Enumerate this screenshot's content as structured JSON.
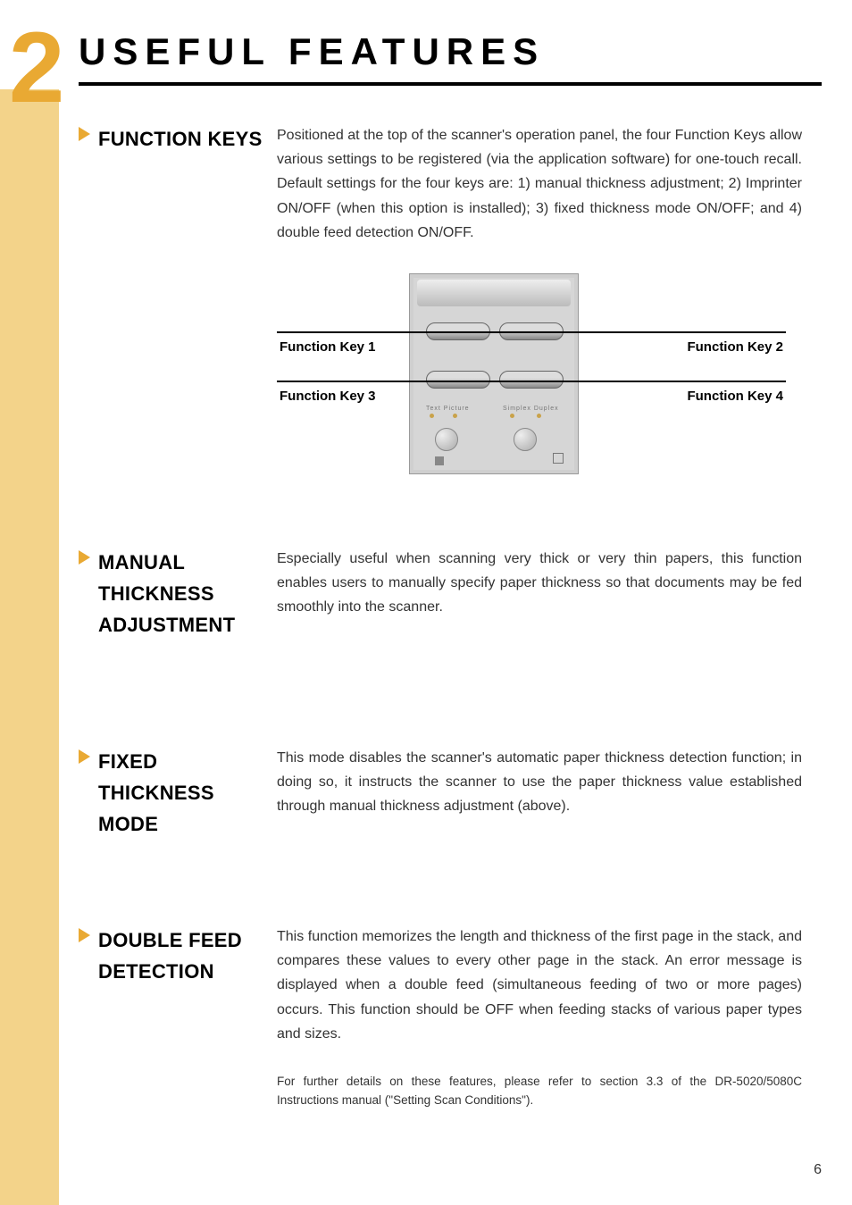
{
  "chapter": {
    "number": "2",
    "title": "USEFUL FEATURES"
  },
  "sections": {
    "function_keys": {
      "heading": "FUNCTION KEYS",
      "body": "Positioned at the top of the scanner's operation panel, the four Function Keys allow various settings to be registered (via the application software) for one-touch recall. Default settings for the four keys are: 1) manual thickness adjustment; 2) Imprinter ON/OFF (when this option is installed); 3) fixed thickness mode ON/OFF; and 4) double feed detection ON/OFF.",
      "fk1": "Function Key 1",
      "fk2": "Function Key 2",
      "fk3": "Function Key 3",
      "fk4": "Function Key 4",
      "panel_labels": {
        "row1": "Text   Picture",
        "row2": "Simplex  Duplex"
      }
    },
    "manual_thickness": {
      "heading": "MANUAL THICKNESS ADJUSTMENT",
      "body": "Especially useful when scanning very thick or very thin papers, this function enables users to manually specify paper thickness so that documents may be fed smoothly into the scanner."
    },
    "fixed_thickness": {
      "heading": "FIXED THICKNESS MODE",
      "body": "This mode disables the scanner's automatic paper thickness detection function; in doing so, it instructs the scanner to use the paper thickness value established through manual thickness adjustment (above)."
    },
    "double_feed": {
      "heading": "DOUBLE FEED DETECTION",
      "body": "This function memorizes the length and thickness of the first page in the stack, and compares these values to every other page in the stack. An error message is displayed when a double feed (simultaneous feeding of two or more pages) occurs. This function should be OFF when feeding stacks of various paper types and sizes."
    }
  },
  "footnote": "For further details on these features, please refer to section 3.3 of the DR-5020/5080C Instructions manual (\"Setting Scan Conditions\").",
  "page_number": "6"
}
